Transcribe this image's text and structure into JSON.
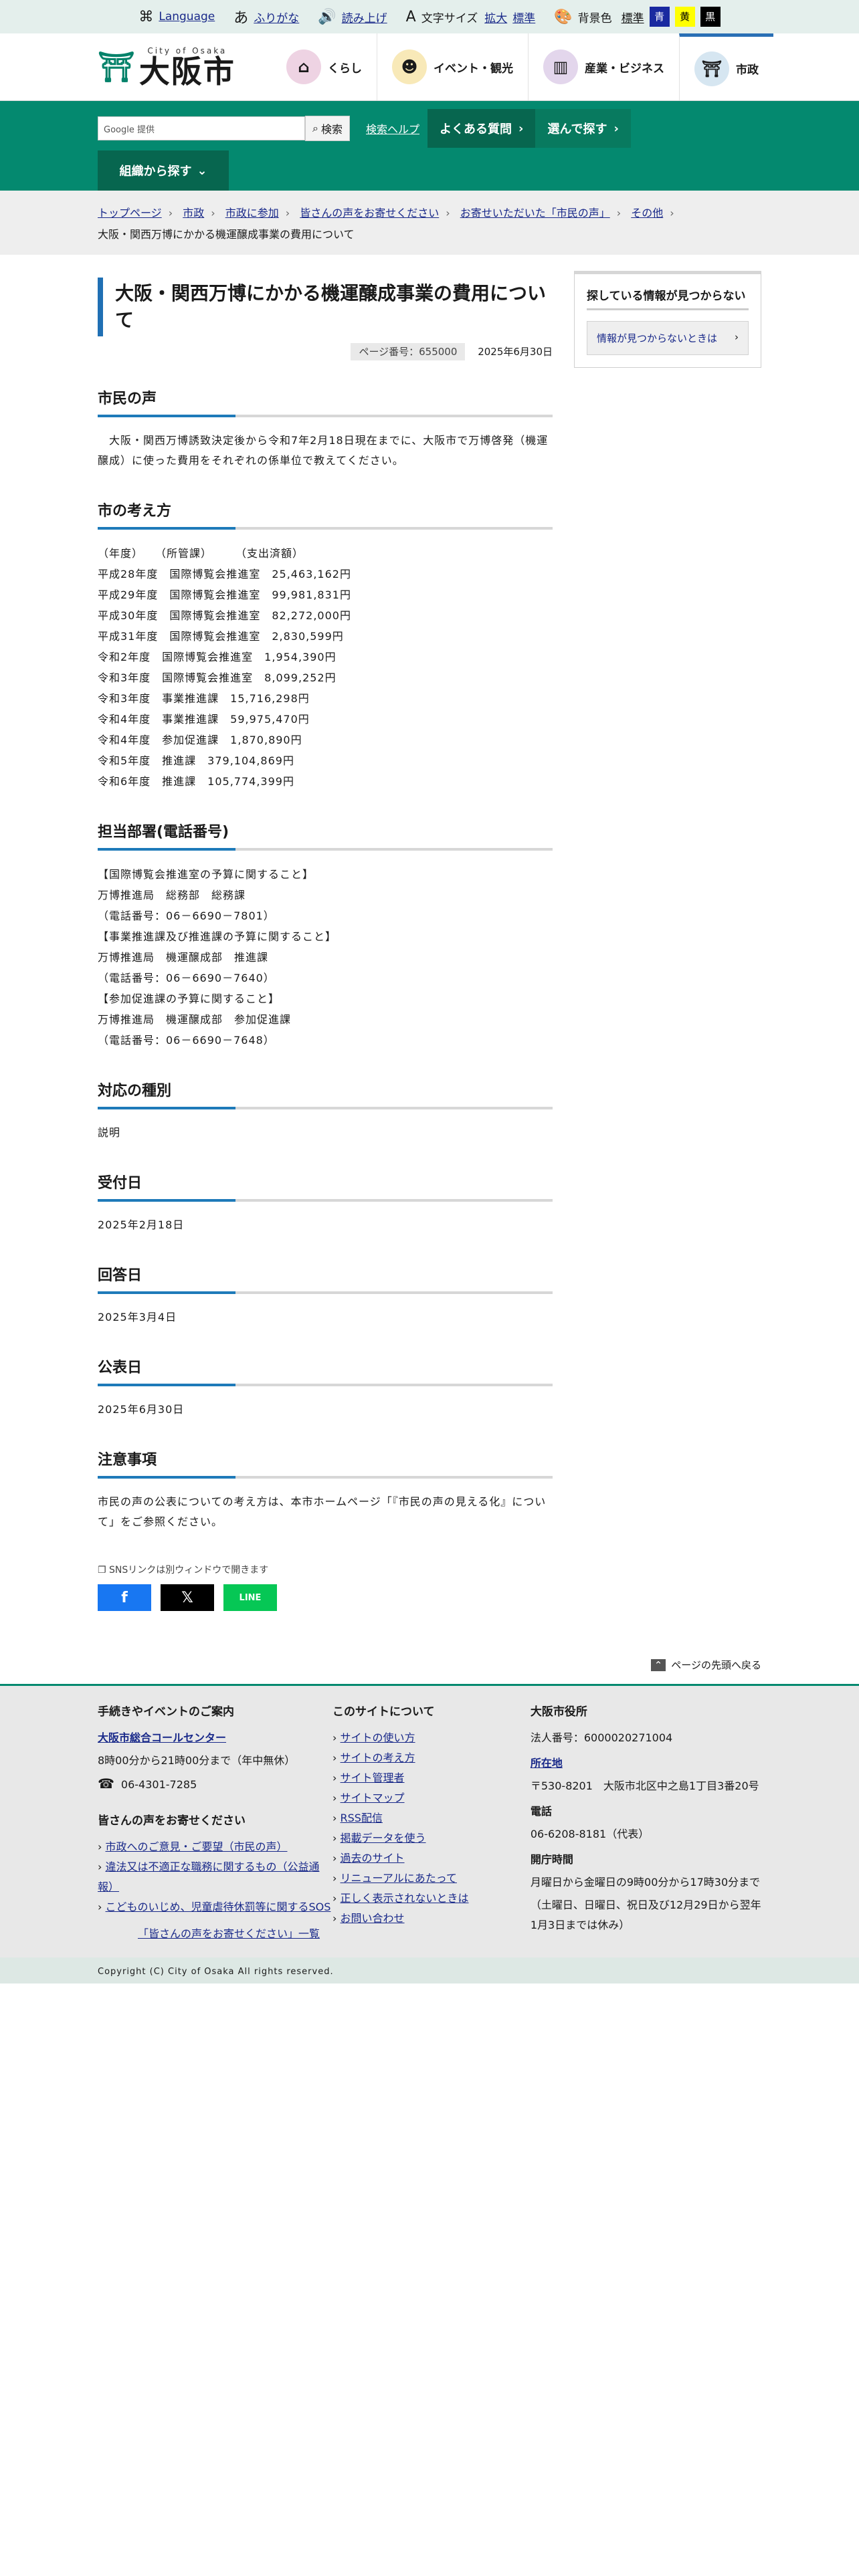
{
  "topbar": {
    "language": "Language",
    "furigana": "ふりがな",
    "read_aloud": "読み上げ",
    "font_size_label": "文字サイズ",
    "font_enlarge": "拡大",
    "font_standard": "標準",
    "bg_label": "背景色",
    "bg_standard": "標準",
    "bg_blue": "青",
    "bg_yellow": "黄",
    "bg_black": "黒"
  },
  "header": {
    "logo_en": "City of Osaka",
    "logo_ja": "大阪市",
    "nav": [
      {
        "label": "くらし",
        "icon": "house-icon",
        "color": "#d9a9c9"
      },
      {
        "label": "イベント・観光",
        "icon": "person-icon",
        "color": "#f3d98c"
      },
      {
        "label": "産業・ビジネス",
        "icon": "building-icon",
        "color": "#c9b0d9"
      },
      {
        "label": "市政",
        "icon": "city-emblem-icon",
        "color": "#bcd6e8"
      }
    ]
  },
  "greenbar": {
    "search_placeholder": "Google 提供",
    "search_button": "検索",
    "search_help": "検索ヘルプ",
    "faq": "よくある質問",
    "choose": "選んで探す",
    "by_org": "組織から探す"
  },
  "breadcrumb": {
    "items": [
      "トップページ",
      "市政",
      "市政に参加",
      "皆さんの声をお寄せください",
      "お寄せいただいた「市民の声」",
      "その他"
    ],
    "current": "大阪・関西万博にかかる機運醸成事業の費用について"
  },
  "page": {
    "title": "大阪・関西万博にかかる機運醸成事業の費用について",
    "page_number": "ページ番号：655000",
    "date": "2025年6月30日",
    "sections": {
      "voice": {
        "heading": "市民の声",
        "text": "　大阪・関西万博誘致決定後から令和7年2月18日現在までに、大阪市で万博啓発（機運醸成）に使った費用をそれぞれの係単位で教えてください。"
      },
      "view": {
        "heading": "市の考え方",
        "lines": [
          "（年度）　　（所管課）　　　（支出済額）",
          "平成28年度　国際博覧会推進室　25,463,162円",
          "平成29年度　国際博覧会推進室　99,981,831円",
          "平成30年度　国際博覧会推進室　82,272,000円",
          "平成31年度　国際博覧会推進室　2,830,599円",
          "令和2年度　国際博覧会推進室　1,954,390円",
          "令和3年度　国際博覧会推進室　8,099,252円",
          "令和3年度　事業推進課　15,716,298円",
          "令和4年度　事業推進課　59,975,470円",
          "令和4年度　参加促進課　1,870,890円",
          "令和5年度　推進課　379,104,869円",
          "令和6年度　推進課　105,774,399円"
        ]
      },
      "dept": {
        "heading": "担当部署(電話番号)",
        "lines": [
          "【国際博覧会推進室の予算に関すること】",
          "万博推進局　総務部　総務課",
          "（電話番号：06－6690－7801）",
          "【事業推進課及び推進課の予算に関すること】",
          "万博推進局　機運醸成部　推進課",
          "（電話番号：06－6690－7640）",
          "【参加促進課の予算に関すること】",
          "万博推進局　機運醸成部　参加促進課",
          "（電話番号：06－6690－7648）"
        ]
      },
      "type": {
        "heading": "対応の種別",
        "text": "説明"
      },
      "received": {
        "heading": "受付日",
        "text": "2025年2月18日"
      },
      "answered": {
        "heading": "回答日",
        "text": "2025年3月4日"
      },
      "published": {
        "heading": "公表日",
        "text": "2025年6月30日"
      },
      "notes": {
        "heading": "注意事項",
        "text": "市民の声の公表についての考え方は、本市ホームページ「『市民の声の見える化』について」をご参照ください。"
      }
    },
    "sns_note": "SNSリンクは別ウィンドウで開きます",
    "sns": [
      {
        "name": "facebook",
        "glyph": "f",
        "color": "#1877f2"
      },
      {
        "name": "x",
        "glyph": "𝕏",
        "color": "#000000"
      },
      {
        "name": "line",
        "glyph": "LINE",
        "color": "#06c755"
      }
    ]
  },
  "sidebar": {
    "title": "探している情報が見つからない",
    "link": "情報が見つからないときは"
  },
  "pagetop": "ページの先頭へ戻る",
  "footer": {
    "col1": {
      "heading": "手続きやイベントのご案内",
      "callcenter": "大阪市総合コールセンター",
      "hours": "8時00分から21時00分まで（年中無休）",
      "phone": "06-4301-7285",
      "voice_heading": "皆さんの声をお寄せください",
      "voice_links": [
        "市政へのご意見・ご要望（市民の声）",
        "違法又は不適正な職務に関するもの（公益通報）",
        "こどものいじめ、児童虐待休罰等に関するSOS"
      ],
      "voice_list": "「皆さんの声をお寄せください」一覧"
    },
    "col2": {
      "heading": "このサイトについて",
      "links": [
        "サイトの使い方",
        "サイトの考え方",
        "サイト管理者",
        "サイトマップ",
        "RSS配信",
        "掲載データを使う",
        "過去のサイト",
        "リニューアルにあたって",
        "正しく表示されないときは",
        "お問い合わせ"
      ]
    },
    "col3": {
      "heading": "大阪市役所",
      "corp_no": "法人番号：6000020271004",
      "address_label": "所在地",
      "address": "〒530-8201　大阪市北区中之島1丁目3番20号",
      "tel_label": "電話",
      "tel": "06-6208-8181（代表）",
      "hours_label": "開庁時間",
      "hours1": "月曜日から金曜日の9時00分から17時30分まで",
      "hours2": "（土曜日、日曜日、祝日及び12月29日から翌年1月3日までは休み）"
    },
    "copyright": "Copyright (C) City of Osaka All rights reserved."
  }
}
